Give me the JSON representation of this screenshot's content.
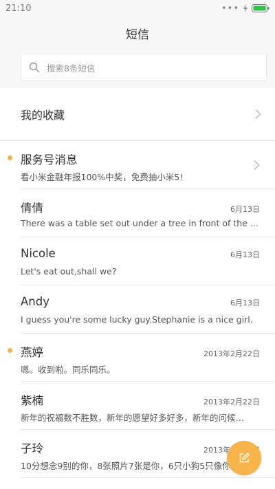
{
  "status_bar": {
    "time": "21:10",
    "signal": "•••"
  },
  "header": {
    "title": "短信"
  },
  "search": {
    "placeholder": "搜索8条短信"
  },
  "favorites": {
    "label": "我的收藏"
  },
  "colors": {
    "accent": "#f7b44a",
    "unread_dot": "#f2b24a",
    "battery": "#2ec34a"
  },
  "messages": [
    {
      "name": "服务号消息",
      "date": "",
      "preview": "看小米金融年报100%中奖，免费抽小米5!",
      "unread": true,
      "chevron": true
    },
    {
      "name": "倩倩",
      "date": "6月13日",
      "preview": "There was a table set out under a tree in front of the ho…",
      "unread": false
    },
    {
      "name": "Nicole",
      "date": "6月13日",
      "preview": "Let's eat out,shall we?",
      "unread": false
    },
    {
      "name": "Andy",
      "date": "6月13日",
      "preview": "I guess you're some lucky guy.Stephanie is a nice girl.",
      "unread": false
    },
    {
      "name": "燕婷",
      "date": "2013年2月22日",
      "preview": "嗯。收到啦。同乐同乐。",
      "unread": true
    },
    {
      "name": "紫楠",
      "date": "2013年2月22日",
      "preview": "新年的祝福数不胜数，新年的愿望好多好多，新年的问候…",
      "unread": false
    },
    {
      "name": "子玲",
      "date": "2013年2月22日",
      "preview": "10分想念9别的你，8张照片7张是你，6只小狗5只像你",
      "unread": false
    }
  ],
  "fab": {
    "icon": "compose-icon"
  }
}
